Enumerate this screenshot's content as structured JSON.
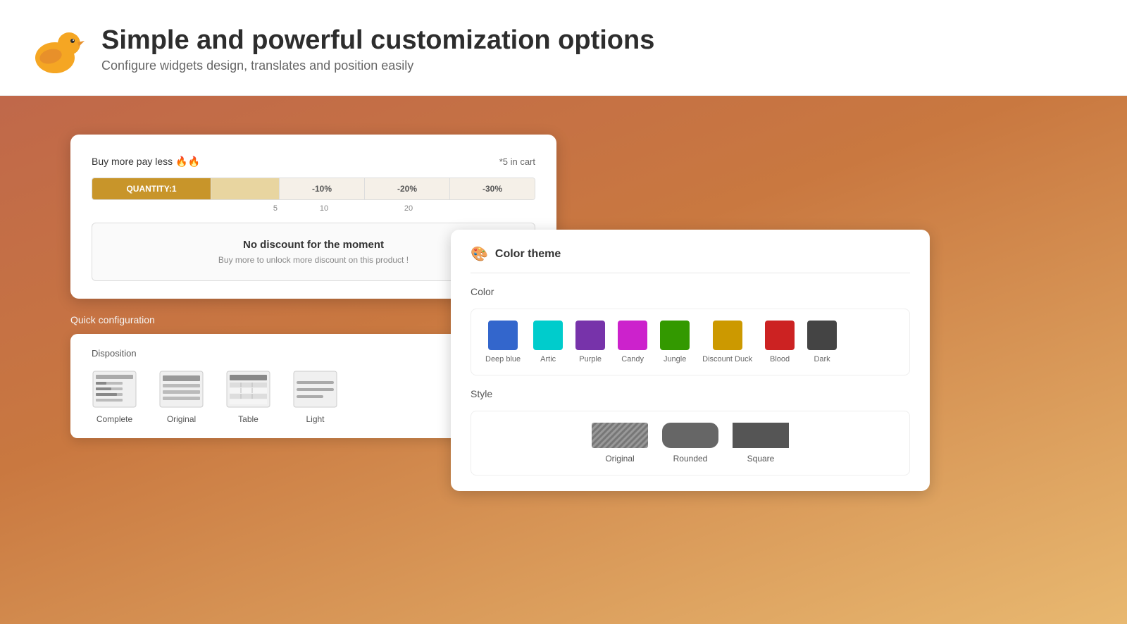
{
  "header": {
    "title": "Simple and powerful customization options",
    "subtitle": "Configure widgets design, translates and position easily"
  },
  "widget1": {
    "buy_more_label": "Buy more pay less 🔥🔥",
    "cart_info": "*5 in cart",
    "segments": [
      {
        "label": "QUANTITY:1",
        "type": "active"
      },
      {
        "label": "",
        "type": "qty"
      },
      {
        "label": "-10%",
        "type": "pct"
      },
      {
        "label": "-20%",
        "type": "pct"
      },
      {
        "label": "-30%",
        "type": "pct"
      }
    ],
    "bar_labels": [
      "5",
      "10",
      "20"
    ],
    "no_discount_title": "No discount for the moment",
    "no_discount_subtitle": "Buy more to unlock more discount on this product !"
  },
  "quick_config": {
    "title": "Quick configuration",
    "disposition_label": "Disposition",
    "options": [
      {
        "label": "Complete",
        "icon_widths": [
          50,
          30,
          40
        ]
      },
      {
        "label": "Original",
        "icon_widths": [
          40,
          40,
          40
        ]
      },
      {
        "label": "Table",
        "icon_widths": [
          45,
          45,
          45
        ]
      },
      {
        "label": "Light",
        "icon_widths": [
          55,
          35
        ]
      }
    ]
  },
  "color_theme": {
    "title": "Color theme",
    "color_section_label": "Color",
    "colors": [
      {
        "name": "Deep blue",
        "hex": "#3366cc"
      },
      {
        "name": "Artic",
        "hex": "#00cccc"
      },
      {
        "name": "Purple",
        "hex": "#7733aa"
      },
      {
        "name": "Candy",
        "hex": "#cc22cc"
      },
      {
        "name": "Jungle",
        "hex": "#339900"
      },
      {
        "name": "Discount Duck",
        "hex": "#cc9900"
      },
      {
        "name": "Blood",
        "hex": "#cc2222"
      },
      {
        "name": "Dark",
        "hex": "#444444"
      }
    ],
    "style_section_label": "Style",
    "styles": [
      {
        "name": "Original",
        "color": "#888888",
        "border_radius": "2px",
        "pattern": "striped"
      },
      {
        "name": "Rounded",
        "color": "#666666",
        "border_radius": "8px",
        "pattern": "solid"
      },
      {
        "name": "Square",
        "color": "#555555",
        "border_radius": "0px",
        "pattern": "solid"
      }
    ]
  }
}
